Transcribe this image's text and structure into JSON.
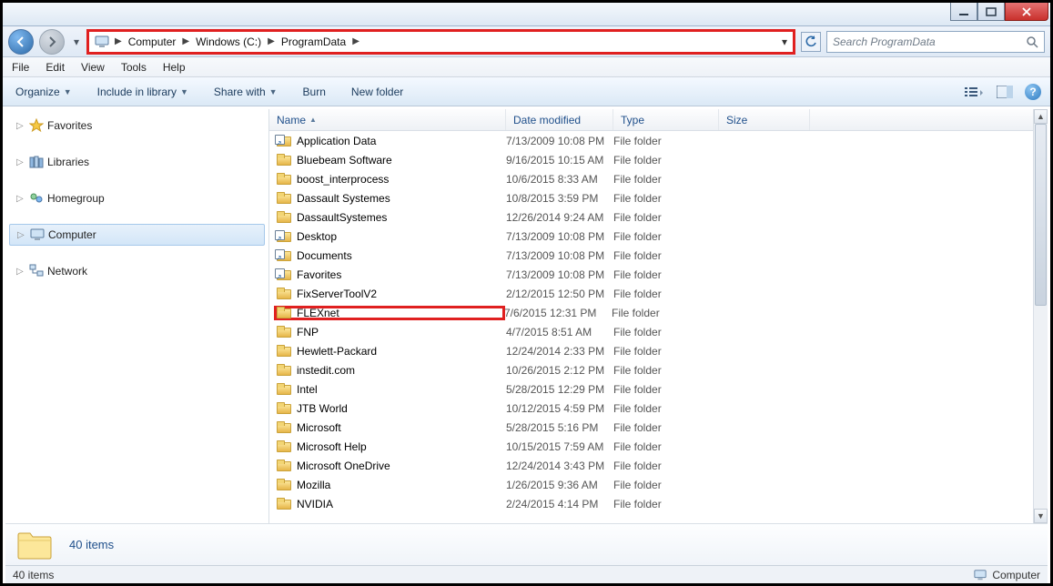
{
  "window": {
    "minimize": "_",
    "maximize": "❐",
    "close": "X"
  },
  "breadcrumbs": [
    "Computer",
    "Windows (C:)",
    "ProgramData"
  ],
  "search": {
    "placeholder": "Search ProgramData"
  },
  "menus": [
    "File",
    "Edit",
    "View",
    "Tools",
    "Help"
  ],
  "commands": {
    "organize": "Organize",
    "include": "Include in library",
    "share": "Share with",
    "burn": "Burn",
    "newfolder": "New folder"
  },
  "tree": {
    "favorites": "Favorites",
    "libraries": "Libraries",
    "homegroup": "Homegroup",
    "computer": "Computer",
    "network": "Network"
  },
  "columns": {
    "name": "Name",
    "date": "Date modified",
    "type": "Type",
    "size": "Size"
  },
  "files": [
    {
      "name": "Application Data",
      "date": "7/13/2009 10:08 PM",
      "type": "File folder",
      "shortcut": true
    },
    {
      "name": "Bluebeam Software",
      "date": "9/16/2015 10:15 AM",
      "type": "File folder"
    },
    {
      "name": "boost_interprocess",
      "date": "10/6/2015 8:33 AM",
      "type": "File folder"
    },
    {
      "name": "Dassault Systemes",
      "date": "10/8/2015 3:59 PM",
      "type": "File folder"
    },
    {
      "name": "DassaultSystemes",
      "date": "12/26/2014 9:24 AM",
      "type": "File folder"
    },
    {
      "name": "Desktop",
      "date": "7/13/2009 10:08 PM",
      "type": "File folder",
      "shortcut": true
    },
    {
      "name": "Documents",
      "date": "7/13/2009 10:08 PM",
      "type": "File folder",
      "shortcut": true
    },
    {
      "name": "Favorites",
      "date": "7/13/2009 10:08 PM",
      "type": "File folder",
      "shortcut": true
    },
    {
      "name": "FixServerToolV2",
      "date": "2/12/2015 12:50 PM",
      "type": "File folder"
    },
    {
      "name": "FLEXnet",
      "date": "7/6/2015 12:31 PM",
      "type": "File folder",
      "hl": true
    },
    {
      "name": "FNP",
      "date": "4/7/2015 8:51 AM",
      "type": "File folder"
    },
    {
      "name": "Hewlett-Packard",
      "date": "12/24/2014 2:33 PM",
      "type": "File folder"
    },
    {
      "name": "instedit.com",
      "date": "10/26/2015 2:12 PM",
      "type": "File folder"
    },
    {
      "name": "Intel",
      "date": "5/28/2015 12:29 PM",
      "type": "File folder"
    },
    {
      "name": "JTB World",
      "date": "10/12/2015 4:59 PM",
      "type": "File folder"
    },
    {
      "name": "Microsoft",
      "date": "5/28/2015 5:16 PM",
      "type": "File folder"
    },
    {
      "name": "Microsoft Help",
      "date": "10/15/2015 7:59 AM",
      "type": "File folder"
    },
    {
      "name": "Microsoft OneDrive",
      "date": "12/24/2014 3:43 PM",
      "type": "File folder"
    },
    {
      "name": "Mozilla",
      "date": "1/26/2015 9:36 AM",
      "type": "File folder"
    },
    {
      "name": "NVIDIA",
      "date": "2/24/2015 4:14 PM",
      "type": "File folder"
    }
  ],
  "details": {
    "count": "40 items"
  },
  "status": {
    "left": "40 items",
    "right": "Computer"
  }
}
